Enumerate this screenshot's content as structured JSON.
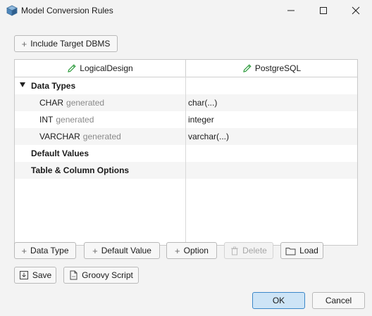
{
  "window": {
    "title": "Model Conversion Rules"
  },
  "toolbar": {
    "include_target_label": "Include Target DBMS"
  },
  "table": {
    "headers": [
      "LogicalDesign",
      "PostgreSQL"
    ],
    "rows": [
      {
        "name": "Data Types",
        "suffix": "",
        "value": ""
      },
      {
        "name": "CHAR",
        "suffix": "generated",
        "value": "char(...)"
      },
      {
        "name": "INT",
        "suffix": "generated",
        "value": "integer"
      },
      {
        "name": "VARCHAR",
        "suffix": "generated",
        "value": "varchar(...)"
      },
      {
        "name": "Default Values",
        "suffix": "",
        "value": ""
      },
      {
        "name": "Table & Column Options",
        "suffix": "",
        "value": ""
      }
    ]
  },
  "actions": {
    "data_type": "Data Type",
    "default_value": "Default Value",
    "option": "Option",
    "delete": "Delete",
    "load": "Load",
    "save": "Save",
    "groovy": "Groovy Script"
  },
  "dialog": {
    "ok": "OK",
    "cancel": "Cancel"
  }
}
